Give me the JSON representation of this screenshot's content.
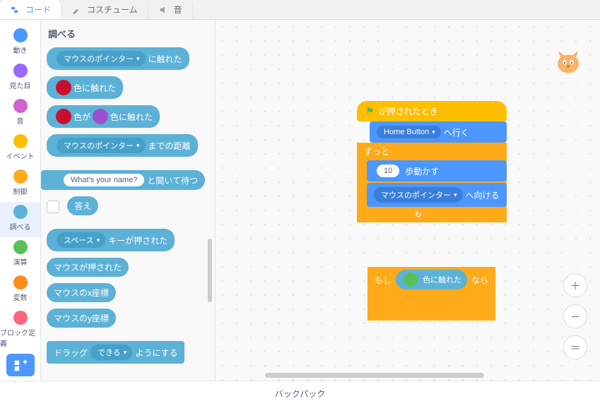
{
  "tabs": {
    "code": "コード",
    "costumes": "コスチューム",
    "sounds": "音"
  },
  "categories": [
    {
      "label": "動き",
      "color": "#4c97ff"
    },
    {
      "label": "見た目",
      "color": "#9966ff"
    },
    {
      "label": "音",
      "color": "#cf63cf"
    },
    {
      "label": "イベント",
      "color": "#ffbf00"
    },
    {
      "label": "制御",
      "color": "#ffab19"
    },
    {
      "label": "調べる",
      "color": "#5cb1d6",
      "active": true
    },
    {
      "label": "演算",
      "color": "#59c059"
    },
    {
      "label": "変数",
      "color": "#ff8c1a"
    },
    {
      "label": "ブロック定義",
      "color": "#ff6680"
    }
  ],
  "palette": {
    "title": "調べる",
    "touching": {
      "drop": "マウスのポインター",
      "suffix": "に触れた"
    },
    "touchingColor": {
      "suffix": "色に触れた",
      "color": "#c8102e"
    },
    "colorTouchingColor": {
      "prefix": "色が",
      "suffix": "色に触れた",
      "c1": "#c8102e",
      "c2": "#9b4fce"
    },
    "distance": {
      "drop": "マウスのポインター",
      "suffix": "までの距離"
    },
    "ask": {
      "input": "What's your name?",
      "suffix": "と聞いて待つ"
    },
    "answer": "答え",
    "keyPressed": {
      "drop": "スペース",
      "suffix": "キーが押された"
    },
    "mouseDown": "マウスが押された",
    "mouseX": "マウスのx座標",
    "mouseY": "マウスのy座標",
    "drag": {
      "prefix": "ドラッグ",
      "drop": "できる",
      "suffix": "ようにする"
    }
  },
  "script1": {
    "hat": "が押されたとき",
    "goto": {
      "drop": "Home Button",
      "suffix": "へ行く"
    },
    "forever": "ずっと",
    "move": {
      "val": "10",
      "suffix": "歩動かす"
    },
    "point": {
      "drop": "マウスのポインター",
      "suffix": "へ向ける"
    }
  },
  "script2": {
    "if_prefix": "もし",
    "touchColor": "色に触れた",
    "touchColorSwatch": "#59c059",
    "if_suffix": "なら"
  },
  "backpack": "バックパック"
}
